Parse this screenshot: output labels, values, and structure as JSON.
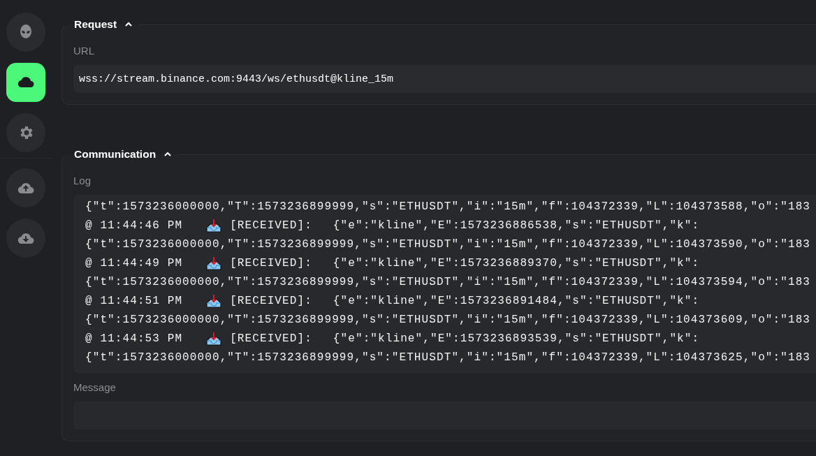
{
  "sidebar": {
    "items": [
      {
        "kind": "alien",
        "selected": false
      },
      {
        "kind": "cloud",
        "selected": true
      },
      {
        "kind": "settings",
        "selected": false
      },
      {
        "kind": "upload",
        "selected": false
      },
      {
        "kind": "download",
        "selected": false
      }
    ]
  },
  "request": {
    "title": "Request",
    "expanded": true,
    "url_label": "URL",
    "url": "wss://stream.binance.com:9443/ws/ethusdt@kline_15m"
  },
  "communication": {
    "title": "Communication",
    "expanded": true,
    "log_label": "Log",
    "log": [
      {
        "kind": "data",
        "text": "{\"t\":1573236000000,\"T\":1573236899999,\"s\":\"ETHUSDT\",\"i\":\"15m\",\"f\":104372339,\"L\":104373588,\"o\":\"183"
      },
      {
        "kind": "received",
        "time": "@ 11:44:46 PM",
        "tag": "[RECEIVED]:",
        "text": "{\"e\":\"kline\",\"E\":1573236886538,\"s\":\"ETHUSDT\",\"k\":"
      },
      {
        "kind": "data",
        "text": "{\"t\":1573236000000,\"T\":1573236899999,\"s\":\"ETHUSDT\",\"i\":\"15m\",\"f\":104372339,\"L\":104373590,\"o\":\"183"
      },
      {
        "kind": "received",
        "time": "@ 11:44:49 PM",
        "tag": "[RECEIVED]:",
        "text": "{\"e\":\"kline\",\"E\":1573236889370,\"s\":\"ETHUSDT\",\"k\":"
      },
      {
        "kind": "data",
        "text": "{\"t\":1573236000000,\"T\":1573236899999,\"s\":\"ETHUSDT\",\"i\":\"15m\",\"f\":104372339,\"L\":104373594,\"o\":\"183"
      },
      {
        "kind": "received",
        "time": "@ 11:44:51 PM",
        "tag": "[RECEIVED]:",
        "text": "{\"e\":\"kline\",\"E\":1573236891484,\"s\":\"ETHUSDT\",\"k\":"
      },
      {
        "kind": "data",
        "text": "{\"t\":1573236000000,\"T\":1573236899999,\"s\":\"ETHUSDT\",\"i\":\"15m\",\"f\":104372339,\"L\":104373609,\"o\":\"183"
      },
      {
        "kind": "received",
        "time": "@ 11:44:53 PM",
        "tag": "[RECEIVED]:",
        "text": "{\"e\":\"kline\",\"E\":1573236893539,\"s\":\"ETHUSDT\",\"k\":"
      },
      {
        "kind": "data",
        "text": "{\"t\":1573236000000,\"T\":1573236899999,\"s\":\"ETHUSDT\",\"i\":\"15m\",\"f\":104372339,\"L\":104373625,\"o\":\"183"
      }
    ],
    "message_label": "Message"
  }
}
